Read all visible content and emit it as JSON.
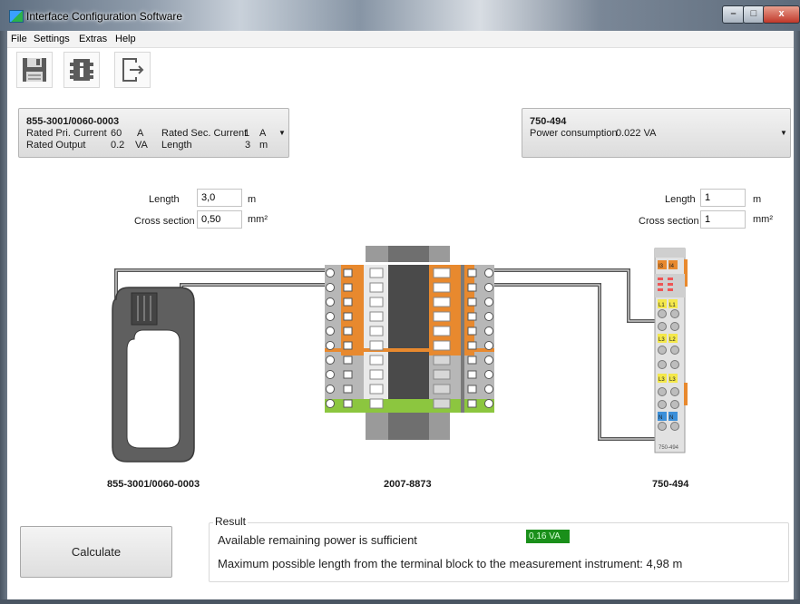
{
  "window": {
    "title": "Interface Configuration Software",
    "controls": {
      "minimize": "–",
      "maximize": "□",
      "close": "x"
    }
  },
  "menu": [
    "File",
    "Settings",
    "Extras",
    "Help"
  ],
  "toolbar": [
    {
      "name": "save",
      "icon": "floppy-disk-icon"
    },
    {
      "name": "info",
      "icon": "info-icon"
    },
    {
      "name": "exit",
      "icon": "exit-icon"
    }
  ],
  "left_device": {
    "id": "855-3001/0060-0003",
    "rows": [
      [
        "Rated Pri. Current",
        "60",
        "A",
        "Rated Sec. Current",
        "1",
        "A"
      ],
      [
        "Rated Output",
        "0.2",
        "VA",
        "Length",
        "3",
        "m"
      ]
    ]
  },
  "right_device": {
    "id": "750-494",
    "power_label": "Power consumption",
    "power_value": "0.022 VA"
  },
  "left_inputs": {
    "length_label": "Length",
    "length_value": "3,0",
    "length_unit": "m",
    "cross_label": "Cross section",
    "cross_value": "0,50",
    "cross_unit": "mm²"
  },
  "right_inputs": {
    "length_label": "Length",
    "length_value": "1",
    "length_unit": "m",
    "cross_label": "Cross section",
    "cross_value": "1",
    "cross_unit": "mm²"
  },
  "diagram_labels": {
    "left": "855-3001/0060-0003",
    "middle": "2007-8873",
    "right": "750-494",
    "module_text": "750-494"
  },
  "module_channels": [
    "I3",
    "I4",
    "L1",
    "L1",
    "L3",
    "L2",
    "L3",
    "L3",
    "N",
    "N"
  ],
  "calculate_label": "Calculate",
  "result": {
    "legend": "Result",
    "sufficient_text": "Available remaining power is sufficient",
    "remaining_power": "0,16 VA",
    "max_length_text": "Maximum possible length from the terminal block to the measurement  instrument: 4,98 m"
  },
  "colors": {
    "terminal_orange": "#e8892e",
    "ground_green": "#8cc63f",
    "cable_gray": "#555555",
    "ok_green": "#1a8f1a",
    "module_yellow": "#f4e84a",
    "module_blue": "#3b8fd9"
  }
}
